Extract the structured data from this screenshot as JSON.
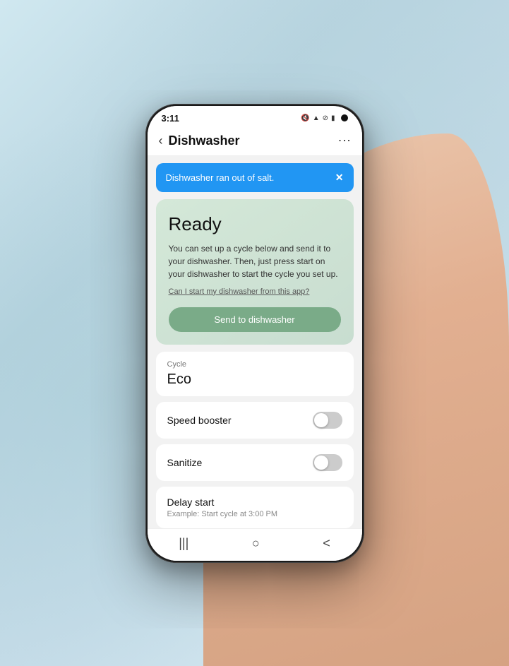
{
  "background": {
    "description": "Blurred outdoor city background with light blue sky"
  },
  "status_bar": {
    "time": "3:11",
    "icons": [
      "mute-icon",
      "wifi-icon",
      "signal-icon",
      "battery-icon"
    ],
    "icon_symbols": [
      "🔇",
      "📶",
      "◉",
      "🔋"
    ]
  },
  "app_bar": {
    "title": "Dishwasher",
    "back_label": "‹",
    "more_label": "⋮"
  },
  "notification": {
    "text": "Dishwasher ran out of salt.",
    "close_label": "✕"
  },
  "ready_card": {
    "title": "Ready",
    "description": "You can set up a cycle below and send it to your dishwasher. Then, just press start on your dishwasher to start the cycle you set up.",
    "link_text": "Can I start my dishwasher from this app?",
    "button_label": "Send to dishwasher"
  },
  "cycle_selector": {
    "label": "Cycle",
    "value": "Eco"
  },
  "toggles": [
    {
      "label": "Speed booster",
      "enabled": false
    },
    {
      "label": "Sanitize",
      "enabled": false
    }
  ],
  "delay_start": {
    "title": "Delay start",
    "subtitle": "Example: Start cycle at 3:00 PM"
  },
  "bottom_nav": {
    "icons": [
      "|||",
      "○",
      "<"
    ]
  }
}
